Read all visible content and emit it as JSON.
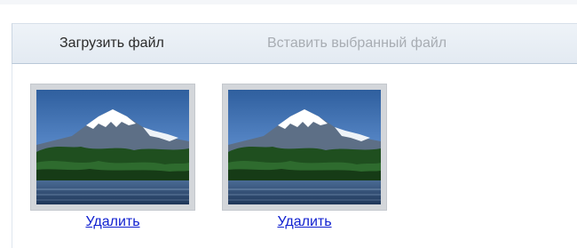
{
  "toolbar": {
    "upload_tab_label": "Загрузить файл",
    "insert_tab_label": "Вставить выбранный файл"
  },
  "files": [
    {
      "delete_label": "Удалить",
      "image_icon": "mountain-lake-photo"
    },
    {
      "delete_label": "Удалить",
      "image_icon": "mountain-lake-photo"
    }
  ],
  "colors": {
    "link": "#1020d0",
    "toolbar_bg": "#e8eef5",
    "active_tab_text": "#2b2b2b",
    "disabled_tab_text": "#a8adb3"
  }
}
